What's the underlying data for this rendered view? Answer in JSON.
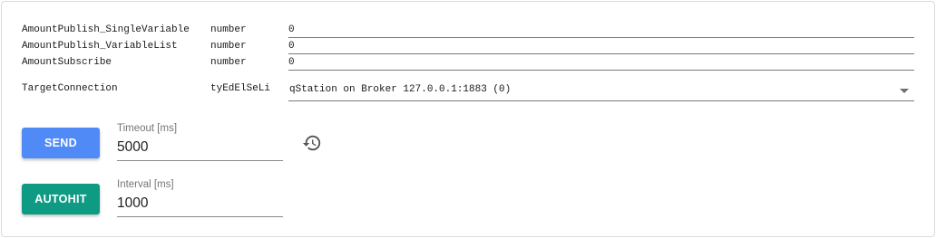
{
  "params": [
    {
      "name": "AmountPublish_SingleVariable",
      "type": "number",
      "value": "0"
    },
    {
      "name": "AmountPublish_VariableList",
      "type": "number",
      "value": "0"
    },
    {
      "name": "AmountSubscribe",
      "type": "number",
      "value": "0"
    }
  ],
  "target": {
    "name": "TargetConnection",
    "type": "tyEdElSeLi",
    "value": "qStation on Broker 127.0.0.1:1883 (0)"
  },
  "send": {
    "label": "SEND",
    "color": "#4f8af7",
    "timeout_label": "Timeout [ms]",
    "timeout_value": "5000",
    "history_icon": "history-icon"
  },
  "autohit": {
    "label": "AUTOHIT",
    "color": "#0f9a84",
    "interval_label": "Interval [ms]",
    "interval_value": "1000"
  }
}
